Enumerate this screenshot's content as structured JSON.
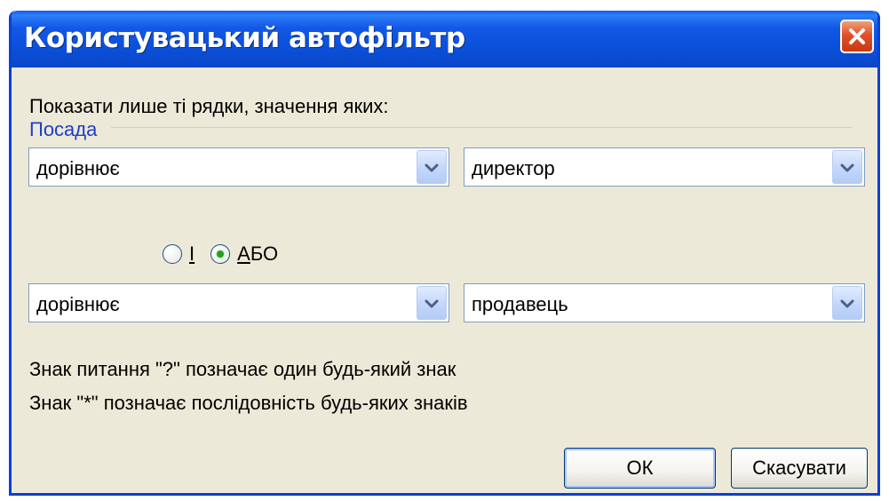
{
  "window": {
    "title": "Користувацький автофільтр"
  },
  "dialog": {
    "instruction": "Показати лише ті рядки, значення яких:",
    "group_label": "Посада",
    "condition1": {
      "operator": "дорівнює",
      "value": "директор"
    },
    "logic": {
      "and_label": "І",
      "or_label": "АБО",
      "selected": "АБО"
    },
    "condition2": {
      "operator": "дорівнює",
      "value": "продавець"
    },
    "hint1": "Знак питання \"?\" позначає один будь-який знак",
    "hint2": "Знак \"*\" позначає послідовність будь-яких знаків",
    "ok_label": "ОК",
    "cancel_label": "Скасувати"
  },
  "icons": {
    "close": "close-icon",
    "dropdown": "chevron-down-icon"
  },
  "colors": {
    "titlebar": "#0a4fd8",
    "dialog_bg": "#ece9d8",
    "close": "#e05028",
    "group_label": "#1e3ec8",
    "radio_selected": "#21a121"
  }
}
